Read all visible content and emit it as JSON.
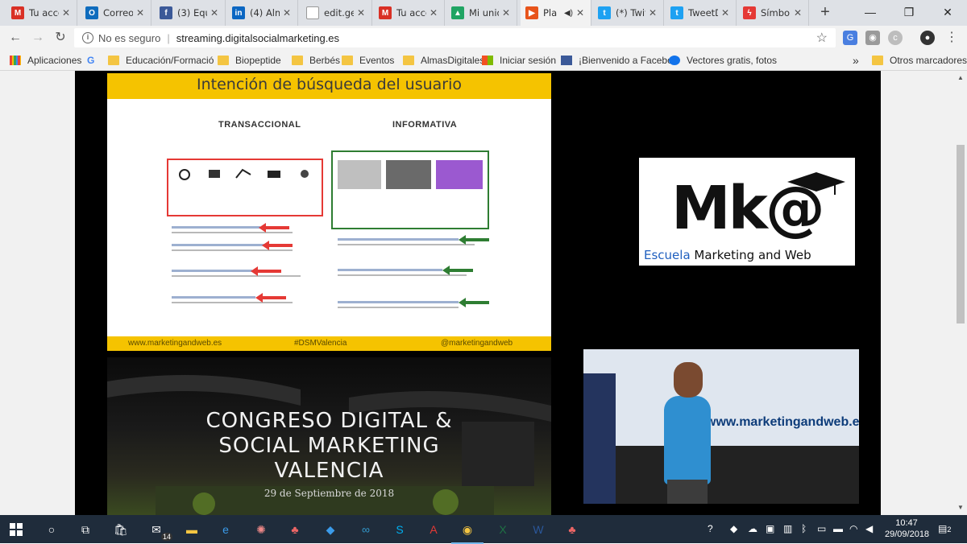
{
  "tabs": [
    {
      "title": "Tu acce",
      "icon": "gmail-icon",
      "color": "#d93025",
      "letter": "M"
    },
    {
      "title": "Correo",
      "icon": "outlook-icon",
      "color": "#0f6cbd",
      "letter": "O"
    },
    {
      "title": "(3) Equ",
      "icon": "facebook-icon",
      "color": "#3b5998",
      "letter": "f"
    },
    {
      "title": "(4) Alm",
      "icon": "linkedin-icon",
      "color": "#0a66c2",
      "letter": "in"
    },
    {
      "title": "edit.ge",
      "icon": "document-icon",
      "color": "#ffffff",
      "letter": ""
    },
    {
      "title": "Tu acce",
      "icon": "gmail-icon",
      "color": "#d93025",
      "letter": "M"
    },
    {
      "title": "Mi unid",
      "icon": "google-drive-icon",
      "color": "#1fa463",
      "letter": "▲"
    },
    {
      "title": "Pla",
      "icon": "play-icon",
      "color": "#e8541a",
      "letter": "▶",
      "audio": "◀)"
    },
    {
      "title": "(*) Twit",
      "icon": "twitter-icon",
      "color": "#1da1f2",
      "letter": "t"
    },
    {
      "title": "TweetD",
      "icon": "tweetdeck-icon",
      "color": "#1da1f2",
      "letter": "t"
    },
    {
      "title": "Símbol",
      "icon": "bolt-icon",
      "color": "#e53935",
      "letter": "ϟ"
    }
  ],
  "window": {
    "new_tab": "+",
    "minimize": "—",
    "restore": "❐",
    "close": "✕"
  },
  "address": {
    "insecure_label": "No es seguro",
    "separator": "|",
    "url": "streaming.digitalsocialmarketing.es"
  },
  "bookmarks": [
    {
      "label": "Aplicaciones",
      "icon": "apps-grid-icon"
    },
    {
      "label": "G",
      "icon": "google-icon"
    },
    {
      "label": "Educación/Formació",
      "icon": "folder-icon"
    },
    {
      "label": "Biopeptide",
      "icon": "folder-icon"
    },
    {
      "label": "Berbés",
      "icon": "folder-icon"
    },
    {
      "label": "Eventos",
      "icon": "folder-icon"
    },
    {
      "label": "AlmasDigitales",
      "icon": "folder-icon"
    },
    {
      "label": "Iniciar sesión",
      "icon": "microsoft-icon"
    },
    {
      "label": "¡Bienvenido a Facebo",
      "icon": "facebook-icon"
    },
    {
      "label": "Vectores gratis, fotos",
      "icon": "freepik-icon"
    }
  ],
  "bookmarks_overflow": "»",
  "other_bookmarks": "Otros marcadores",
  "slide": {
    "title": "Intención de búsqueda del usuario",
    "left_label": "TRANSACCIONAL",
    "right_label": "INFORMATIVA",
    "footer_left": "www.marketingandweb.es",
    "footer_center": "#DSMValencia",
    "footer_right": "@marketingandweb"
  },
  "logo": {
    "mark": "Mk@",
    "sub_blue": "Escuela",
    "sub_black": "Marketing and Web"
  },
  "congress": {
    "title_line1": "CONGRESO DIGITAL &",
    "title_line2": "SOCIAL MARKETING",
    "title_line3": "VALENCIA",
    "date": "29 de Septiembre de 2018"
  },
  "camera": {
    "screen_text": "www.marketingandweb.e"
  },
  "taskbar": {
    "time": "10:47",
    "date": "29/09/2018",
    "mail_badge": "14",
    "notification_badge": "2"
  }
}
